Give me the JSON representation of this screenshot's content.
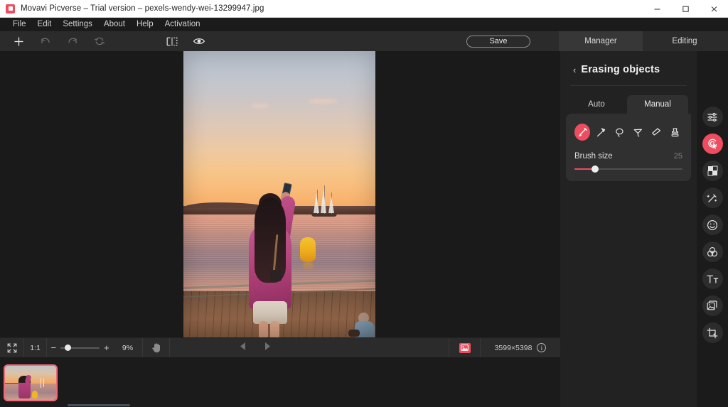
{
  "window": {
    "title": "Movavi Picverse – Trial version – pexels-wendy-wei-13299947.jpg",
    "app_icon": "movavi-logo-icon",
    "controls": {
      "minimize": "minimize-icon",
      "maximize": "maximize-icon",
      "close": "close-icon"
    }
  },
  "menubar": {
    "items": [
      {
        "label": "File"
      },
      {
        "label": "Edit"
      },
      {
        "label": "Settings"
      },
      {
        "label": "About"
      },
      {
        "label": "Help"
      },
      {
        "label": "Activation"
      }
    ]
  },
  "toolbar": {
    "icons": [
      {
        "name": "add-icon",
        "enabled": true
      },
      {
        "name": "undo-icon",
        "enabled": false
      },
      {
        "name": "redo-icon",
        "enabled": false
      },
      {
        "name": "reset-icon",
        "enabled": false
      },
      {
        "name": "compare-before-after-icon",
        "enabled": true
      },
      {
        "name": "preview-eye-icon",
        "enabled": true
      }
    ],
    "save_label": "Save",
    "tabs": [
      {
        "label": "Manager",
        "active": true
      },
      {
        "label": "Editing",
        "active": false
      }
    ]
  },
  "canvas": {
    "image_filename": "pexels-wendy-wei-13299947.jpg",
    "description": "Woman in pink top photographing a sunset over water from a wooden pier"
  },
  "bottombar": {
    "fit_icon": "fit-to-screen-icon",
    "ratio_label": "1:1",
    "zoom": {
      "minus": "−",
      "plus": "+",
      "percent_label": "9%",
      "value": 9,
      "handle_position_pct": 10
    },
    "hand_icon": "hand-tool-icon",
    "prev_icon": "previous-image-icon",
    "next_icon": "next-image-icon",
    "image_chip_icon": "image-thumbnail-icon",
    "dimensions_label": "3599×5398",
    "info_icon": "info-icon",
    "info_glyph": "i"
  },
  "filmstrip": {
    "thumbnails": [
      {
        "name": "thumbnail-1",
        "selected": true
      }
    ]
  },
  "panel": {
    "back_chevron": "‹",
    "title": "Erasing objects",
    "tabs": [
      {
        "label": "Auto",
        "active": false
      },
      {
        "label": "Manual",
        "active": true
      }
    ],
    "tools": [
      {
        "name": "brush-tool-icon",
        "active": true
      },
      {
        "name": "magic-wand-tool-icon",
        "active": false
      },
      {
        "name": "lasso-tool-icon",
        "active": false
      },
      {
        "name": "polygonal-lasso-tool-icon",
        "active": false
      },
      {
        "name": "eraser-tool-icon",
        "active": false
      },
      {
        "name": "stamp-tool-icon",
        "active": false
      }
    ],
    "brush_size": {
      "label": "Brush size",
      "value": "25",
      "fill_pct": 19
    }
  },
  "rail": {
    "items": [
      {
        "name": "adjustments-icon",
        "active": false
      },
      {
        "name": "object-removal-icon",
        "active": true
      },
      {
        "name": "background-removal-icon",
        "active": false
      },
      {
        "name": "retouch-wand-icon",
        "active": false
      },
      {
        "name": "face-smiley-icon",
        "active": false
      },
      {
        "name": "color-mixer-icon",
        "active": false
      },
      {
        "name": "text-icon",
        "active": false
      },
      {
        "name": "frames-icon",
        "active": false
      },
      {
        "name": "crop-icon",
        "active": false
      }
    ]
  },
  "colors": {
    "accent": "#ef4c5f",
    "panel_bg": "#222222",
    "toolbar_bg": "#2b2b2b",
    "app_bg": "#1b1b1b",
    "titlebar_bg": "#ffffff"
  }
}
